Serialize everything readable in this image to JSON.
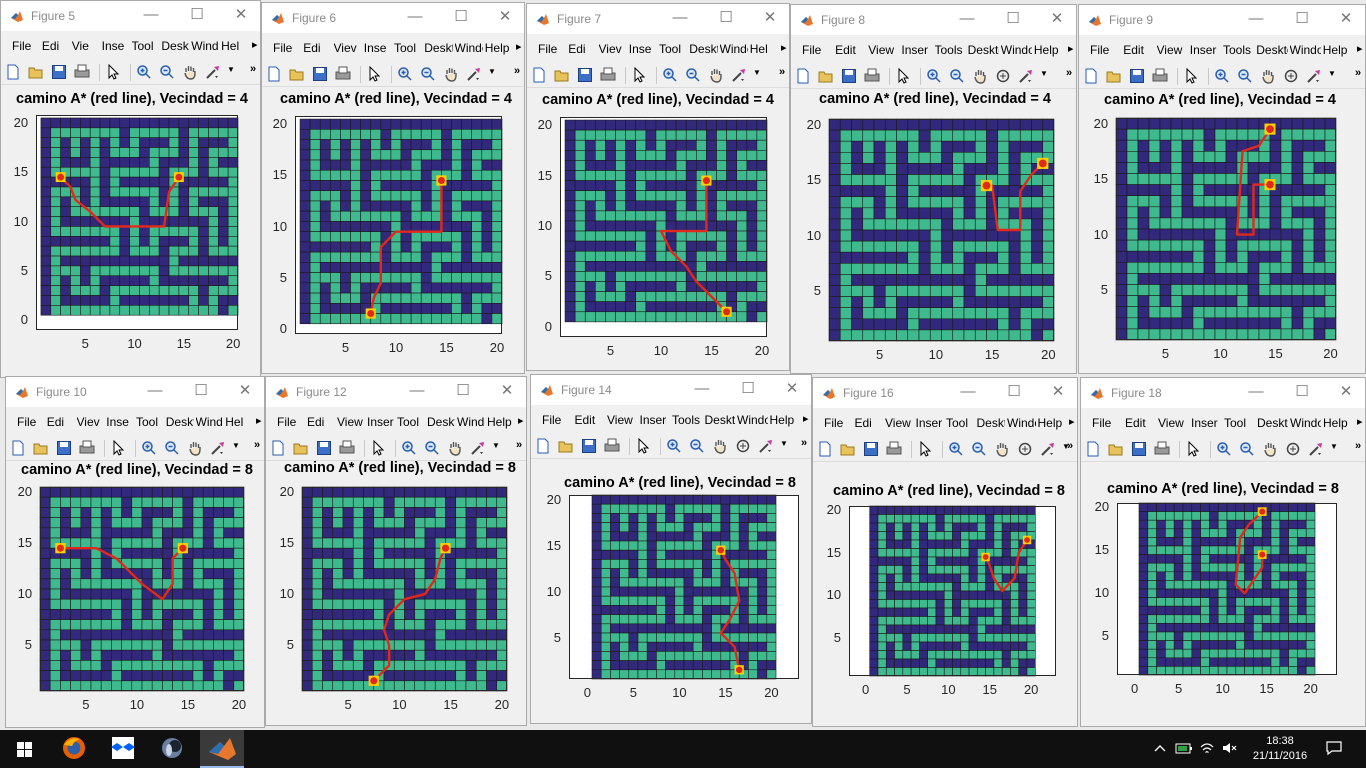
{
  "windows": [
    {
      "id": "fig5",
      "title": "Figure 5",
      "plot_title": "camino A* (red line), Vecindad = 4",
      "menus": [
        "File",
        "Edi",
        "Vie",
        "Inse",
        "Tool",
        "Deskt",
        "Windc",
        "Hel"
      ],
      "extended_tools": false,
      "xticks": [
        "5",
        "10",
        "15",
        "20"
      ],
      "yticks": [
        "0",
        "5",
        "10",
        "15",
        "20"
      ],
      "path": [
        [
          2.5,
          14.5
        ],
        [
          3.5,
          13.5
        ],
        [
          4,
          12.2
        ],
        [
          5.5,
          11
        ],
        [
          7,
          9.5
        ],
        [
          13,
          9.5
        ],
        [
          13.5,
          13
        ],
        [
          14.5,
          14.5
        ]
      ],
      "start": [
        2.5,
        14.5
      ],
      "goal": [
        14.5,
        14.5
      ]
    },
    {
      "id": "fig6",
      "title": "Figure 6",
      "plot_title": "camino A* (red line), Vecindad = 4",
      "menus": [
        "File",
        "Edi",
        "Viev",
        "Inse",
        "Tool",
        "Deskt",
        "Windc",
        "Help"
      ],
      "extended_tools": false,
      "xticks": [
        "5",
        "10",
        "15",
        "20"
      ],
      "yticks": [
        "0",
        "5",
        "10",
        "15",
        "20"
      ],
      "path": [
        [
          7.5,
          1.5
        ],
        [
          7.8,
          3
        ],
        [
          8.5,
          4.5
        ],
        [
          8.5,
          8
        ],
        [
          10,
          9.5
        ],
        [
          14.5,
          9.5
        ],
        [
          14.5,
          14.5
        ]
      ],
      "start": [
        7.5,
        1.5
      ],
      "goal": [
        14.5,
        14.5
      ]
    },
    {
      "id": "fig7",
      "title": "Figure 7",
      "plot_title": "camino A* (red line), Vecindad = 4",
      "menus": [
        "File",
        "Edi",
        "Viev",
        "Inse",
        "Tool",
        "Deskt",
        "Windc",
        "Hel"
      ],
      "extended_tools": false,
      "xticks": [
        "5",
        "10",
        "15",
        "20"
      ],
      "yticks": [
        "0",
        "5",
        "10",
        "15",
        "20"
      ],
      "path": [
        [
          16.5,
          1.5
        ],
        [
          15,
          3
        ],
        [
          13.5,
          4.5
        ],
        [
          12.5,
          6
        ],
        [
          11,
          7.5
        ],
        [
          10,
          9.5
        ],
        [
          14.5,
          9.5
        ],
        [
          14.5,
          14.5
        ]
      ],
      "start": [
        16.5,
        1.5
      ],
      "goal": [
        14.5,
        14.5
      ]
    },
    {
      "id": "fig8",
      "title": "Figure 8",
      "plot_title": "camino A* (red line), Vecindad = 4",
      "menus": [
        "File",
        "Edit",
        "View",
        "Inser",
        "Tools",
        "Deskto",
        "Windov",
        "Help"
      ],
      "extended_tools": true,
      "xticks": [
        "5",
        "10",
        "15",
        "20"
      ],
      "yticks": [
        "5",
        "10",
        "15",
        "20"
      ],
      "path": [
        [
          19.5,
          16.5
        ],
        [
          18.5,
          15.5
        ],
        [
          17.5,
          14
        ],
        [
          17.5,
          10.5
        ],
        [
          15.5,
          10.5
        ],
        [
          15,
          14.5
        ],
        [
          14.5,
          14.5
        ]
      ],
      "start": [
        19.5,
        16.5
      ],
      "goal": [
        14.5,
        14.5
      ]
    },
    {
      "id": "fig9",
      "title": "Figure 9",
      "plot_title": "camino A* (red line), Vecindad = 4",
      "menus": [
        "File",
        "Edit",
        "View",
        "Inser",
        "Tools",
        "Deskto",
        "Windo",
        "Help"
      ],
      "extended_tools": true,
      "xticks": [
        "5",
        "10",
        "15",
        "20"
      ],
      "yticks": [
        "5",
        "10",
        "15",
        "20"
      ],
      "path": [
        [
          14.5,
          19.5
        ],
        [
          13.5,
          18
        ],
        [
          12,
          17.5
        ],
        [
          11.5,
          10
        ],
        [
          13,
          10
        ],
        [
          13,
          14.5
        ],
        [
          14.5,
          14.5
        ]
      ],
      "start": [
        14.5,
        19.5
      ],
      "goal": [
        14.5,
        14.5
      ]
    },
    {
      "id": "fig10",
      "title": "Figure 10",
      "plot_title": "camino A* (red line), Vecindad = 8",
      "menus": [
        "File",
        "Edi",
        "Viev",
        "Inse",
        "Tool",
        "Deskt",
        "Windc",
        "Hel"
      ],
      "extended_tools": false,
      "xticks": [
        "5",
        "10",
        "15",
        "20"
      ],
      "yticks": [
        "5",
        "10",
        "15",
        "20"
      ],
      "path": [
        [
          2.5,
          14.5
        ],
        [
          6,
          14.5
        ],
        [
          8,
          13.5
        ],
        [
          10.5,
          11
        ],
        [
          12.5,
          9.5
        ],
        [
          13.5,
          11
        ],
        [
          13.5,
          13.5
        ],
        [
          14.5,
          14.5
        ]
      ],
      "start": [
        2.5,
        14.5
      ],
      "goal": [
        14.5,
        14.5
      ]
    },
    {
      "id": "fig12",
      "title": "Figure 12",
      "plot_title": "camino A* (red line), Vecindad = 8",
      "menus": [
        "File",
        "Edi",
        "View",
        "Inser",
        "Tool",
        "Deskt",
        "Windc",
        "Help"
      ],
      "extended_tools": false,
      "xticks": [
        "5",
        "10",
        "15",
        "20"
      ],
      "yticks": [
        "5",
        "10",
        "15",
        "20"
      ],
      "path": [
        [
          7.5,
          1.5
        ],
        [
          9,
          3
        ],
        [
          9,
          5
        ],
        [
          8.5,
          6.5
        ],
        [
          9,
          8
        ],
        [
          10.5,
          9.5
        ],
        [
          12.5,
          10
        ],
        [
          13.5,
          11.5
        ],
        [
          14,
          13.5
        ],
        [
          14.5,
          14.5
        ]
      ],
      "start": [
        7.5,
        1.5
      ],
      "goal": [
        14.5,
        14.5
      ]
    },
    {
      "id": "fig14",
      "title": "Figure 14",
      "plot_title": "camino A* (red line), Vecindad = 8",
      "menus": [
        "File",
        "Edit",
        "View",
        "Inser",
        "Tools",
        "Deskto",
        "Windov",
        "Help"
      ],
      "extended_tools": true,
      "xticks": [
        "0",
        "5",
        "10",
        "15",
        "20"
      ],
      "yticks": [
        "5",
        "10",
        "15",
        "20"
      ],
      "path": [
        [
          16.5,
          1.5
        ],
        [
          16,
          4
        ],
        [
          14.5,
          5.5
        ],
        [
          15.5,
          7
        ],
        [
          16.5,
          9
        ],
        [
          16,
          12
        ],
        [
          15,
          13.5
        ],
        [
          14.5,
          14.5
        ]
      ],
      "start": [
        16.5,
        1.5
      ],
      "goal": [
        14.5,
        14.5
      ]
    },
    {
      "id": "fig16",
      "title": "Figure 16",
      "plot_title": "camino A* (red line), Vecindad = 8",
      "menus": [
        "File",
        "Edi",
        "View",
        "Inser",
        "Tool",
        "Deskt",
        "Windo",
        "Help"
      ],
      "extended_tools": true,
      "xticks": [
        "0",
        "5",
        "10",
        "15",
        "20"
      ],
      "yticks": [
        "5",
        "10",
        "15",
        "20"
      ],
      "path": [
        [
          19.5,
          16.5
        ],
        [
          18.5,
          15
        ],
        [
          18,
          12
        ],
        [
          16.5,
          10.5
        ],
        [
          15.5,
          12
        ],
        [
          15,
          13.5
        ],
        [
          14.5,
          14.5
        ]
      ],
      "start": [
        19.5,
        16.5
      ],
      "goal": [
        14.5,
        14.5
      ]
    },
    {
      "id": "fig18",
      "title": "Figure 18",
      "plot_title": "camino A* (red line), Vecindad = 8",
      "menus": [
        "File",
        "Edit",
        "View",
        "Inser",
        "Tool",
        "Deskto",
        "Windo",
        "Help"
      ],
      "extended_tools": true,
      "xticks": [
        "0",
        "5",
        "10",
        "15",
        "20"
      ],
      "yticks": [
        "5",
        "10",
        "15",
        "20"
      ],
      "path": [
        [
          14.5,
          19.5
        ],
        [
          13,
          18
        ],
        [
          12,
          16.5
        ],
        [
          11.5,
          11
        ],
        [
          12.5,
          10
        ],
        [
          13.5,
          11.5
        ],
        [
          14.5,
          13
        ],
        [
          14.5,
          14.5
        ]
      ],
      "start": [
        14.5,
        19.5
      ],
      "goal": [
        14.5,
        14.5
      ]
    }
  ],
  "maze": {
    "open_color": "#3fba8f",
    "wall_color": "#32287c",
    "grid_line_color": "#1a1a1a",
    "path_color": "#e1291b",
    "marker_color": "#ffd000",
    "rows": [
      "XXXXXXXXXXXXXXXXXXXXX",
      "X.......X.....X.....X",
      "X.X.X.X.X.XXX.X.XXX.X",
      "X.X.X.X...X...X.X...X",
      "X.XXX.XXXXX.XXX.X.XXX",
      "X.....X.....X...X...X",
      "XXXXX.X.XXXXX.XXXXX.X",
      "X...X.X.....X.X.....X",
      "X.X.X.XXXXX.X.X.XXX.X",
      "X.X.......X...X...X.X",
      "X.XXXXXXX.XXXXXXX.X.X",
      "X.......X.X.....X.X.X",
      "XXXXXXX.X.X.XXX.X.X.X",
      "X.......X...X...X...X",
      "X.XXXXXXXXXXX.XXXXXXX",
      "X...X.......X.......X",
      "X.X.X.XXXXX.XXXXXXX.X",
      "X.X...X.........X...X",
      "X.XXXXX.XXXXXXX.X.XXX",
      "X.................X.X",
      "XXXXXXXXXXXXXXXXXXXXX"
    ]
  },
  "taskbar": {
    "apps": [
      "start-button",
      "firefox",
      "dropbox",
      "cortana-app",
      "matlab"
    ],
    "time": "18:38",
    "date": "21/11/2016"
  }
}
